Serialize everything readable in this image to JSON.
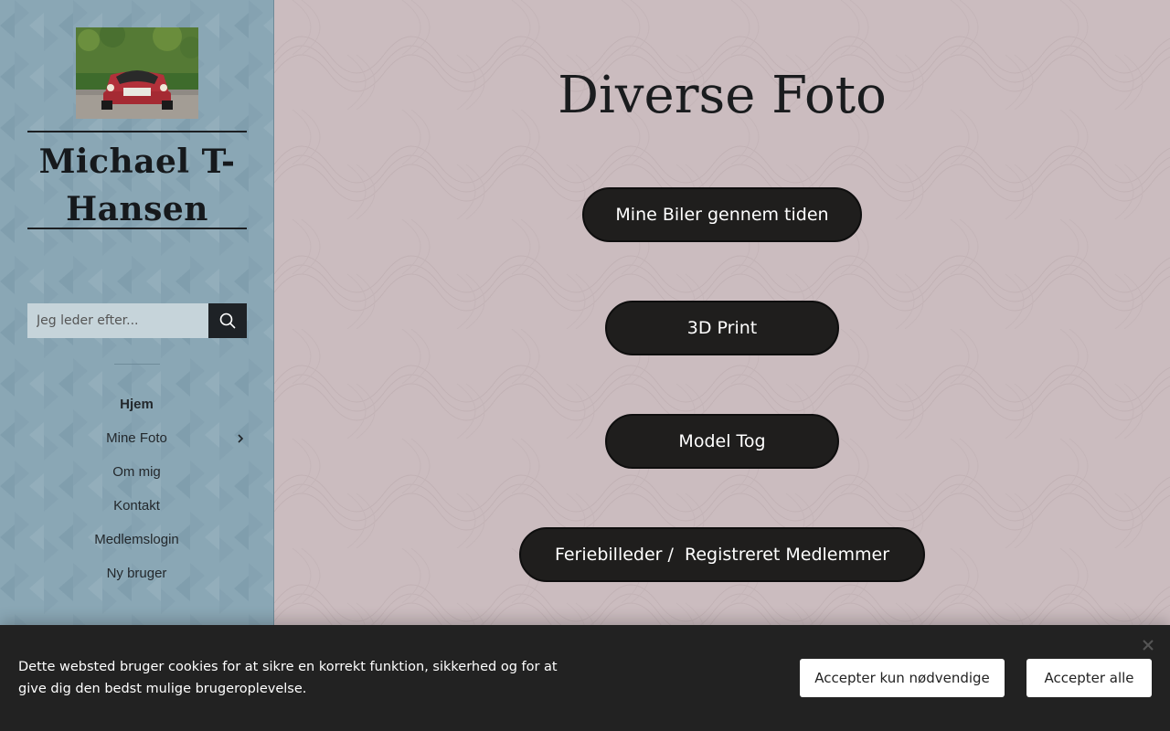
{
  "sidebar": {
    "site_title": "Michael T-Hansen",
    "search": {
      "placeholder": "Jeg leder efter...",
      "button_icon": "search-icon"
    },
    "nav": [
      {
        "label": "Hjem",
        "active": true
      },
      {
        "label": "Mine Foto",
        "has_submenu": true
      },
      {
        "label": "Om mig"
      },
      {
        "label": "Kontakt"
      },
      {
        "label": "Medlemslogin"
      },
      {
        "label": "Ny bruger"
      }
    ],
    "background_color": "#8aa7b5"
  },
  "main": {
    "title": "Diverse Foto",
    "buttons": [
      {
        "label": "Mine Biler gennem tiden"
      },
      {
        "label": "3D Print"
      },
      {
        "label": "Model Tog"
      },
      {
        "label": "Feriebilleder /  Registreret Medlemmer"
      }
    ],
    "background_color": "#cbbcbf"
  },
  "cookie_banner": {
    "text": "Dette websted bruger cookies for at sikre en korrekt funktion, sikkerhed og for at give dig den bedst mulige brugeroplevelse.",
    "accept_necessary_label": "Accepter kun nødvendige",
    "accept_all_label": "Accepter alle",
    "close_icon": "close-icon",
    "background_color": "#222222"
  }
}
